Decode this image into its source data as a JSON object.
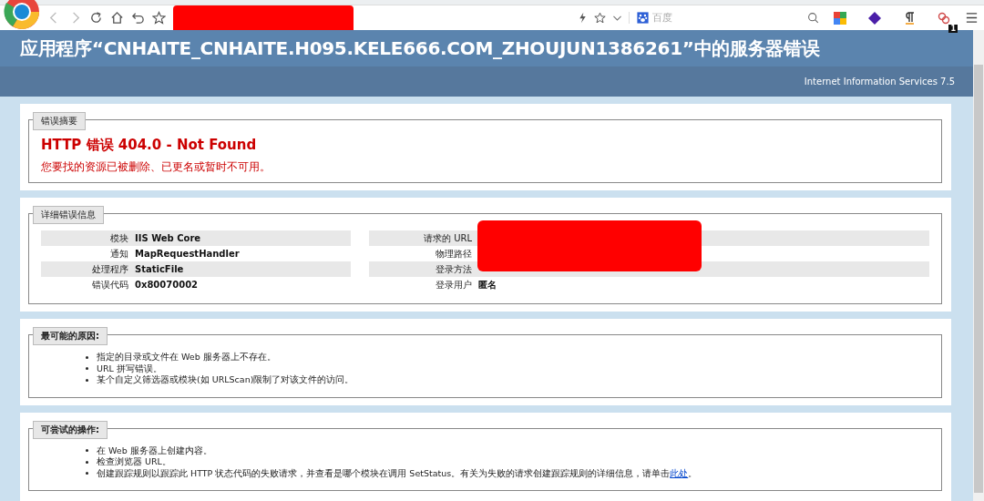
{
  "browser": {
    "search_placeholder": "百度",
    "extension_badge": "1"
  },
  "header": {
    "title": "应用程序“CNHAITE_CNHAITE.H095.KELE666.COM_ZHOUJUN1386261”中的服务器错误",
    "server": "Internet Information Services 7.5"
  },
  "summary": {
    "legend": "错误摘要",
    "heading": "HTTP 错误 404.0 - Not Found",
    "message": "您要找的资源已被删除、已更名或暂时不可用。"
  },
  "details": {
    "legend": "详细错误信息",
    "left": [
      {
        "label": "模块",
        "value": "IIS Web Core"
      },
      {
        "label": "通知",
        "value": "MapRequestHandler"
      },
      {
        "label": "处理程序",
        "value": "StaticFile"
      },
      {
        "label": "错误代码",
        "value": "0x80070002"
      }
    ],
    "right": [
      {
        "label": "请求的 URL"
      },
      {
        "label": "物理路径"
      },
      {
        "label": "登录方法"
      },
      {
        "label": "登录用户",
        "value": "匿名"
      }
    ]
  },
  "causes": {
    "legend": "最可能的原因:",
    "items": [
      {
        "text": "指定的目录或文件在 Web 服务器上不存在。"
      },
      {
        "text": "URL 拼写错误。"
      },
      {
        "text": "某个自定义筛选器或模块(如 URLScan)限制了对该文件的访问。"
      }
    ]
  },
  "actions": {
    "legend": "可尝试的操作:",
    "items": [
      {
        "text": "在 Web 服务器上创建内容。"
      },
      {
        "text": "检查浏览器 URL。"
      },
      {
        "text": "创建跟踪规则以跟踪此 HTTP 状态代码的失败请求，并查看是哪个模块在调用 SetStatus。有关为失败的请求创建跟踪规则的详细信息，请单击",
        "link": "此处",
        "after": "。"
      }
    ]
  }
}
